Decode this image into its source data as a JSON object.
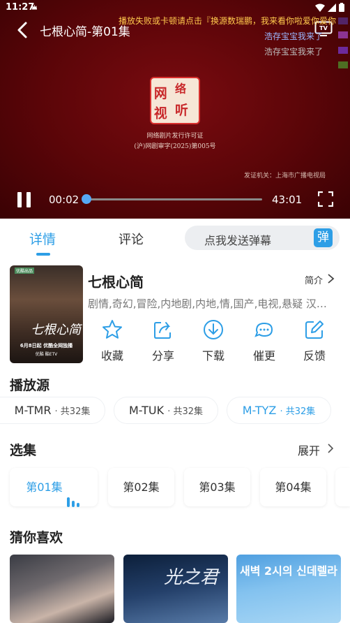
{
  "status_bar": {
    "time": "11:27"
  },
  "player": {
    "title": "七根心简-第01集",
    "danmaku": [
      "播放失败或卡顿请点击『换源数瑞鹏，我来看你啦爱你爱你",
      "浩存宝宝我来了",
      "浩存宝宝我来了"
    ],
    "certificate_line1": "网络剧片发行许可证",
    "certificate_line2": "(沪)网剧审字(2025)第005号",
    "issuer": "发证机关：上海市广播电视局",
    "current_time": "00:02",
    "total_time": "43:01",
    "progress_percent": 0.1,
    "colors": {
      "accent": "#4a9ff0",
      "background": "#5a0508"
    }
  },
  "tabs": {
    "detail_label": "详情",
    "comment_label": "评论",
    "danmu_placeholder": "点我发送弹幕",
    "danmu_button": "弹"
  },
  "show": {
    "title": "七根心简",
    "intro_label": "简介",
    "genres": "剧情,奇幻,冒险,内地剧,内地,情,国产,电视,悬疑 汉…",
    "poster": {
      "title": "七根心简",
      "date": "6月8日起 优酷全网独播",
      "platform": "优酷 酷ETV"
    }
  },
  "actions": [
    {
      "icon": "star-icon",
      "label": "收藏"
    },
    {
      "icon": "share-icon",
      "label": "分享"
    },
    {
      "icon": "download-icon",
      "label": "下载"
    },
    {
      "icon": "remind-icon",
      "label": "催更"
    },
    {
      "icon": "feedback-icon",
      "label": "反馈"
    }
  ],
  "sources": {
    "heading": "播放源",
    "items": [
      {
        "name": "M-TMR",
        "count": "· 共32集"
      },
      {
        "name": "M-TUK",
        "count": "· 共32集"
      },
      {
        "name": "M-TYZ",
        "count": "· 共32集",
        "active": true
      }
    ]
  },
  "episodes": {
    "heading": "选集",
    "expand_label": "展开",
    "items": [
      "第01集",
      "第02集",
      "第03集",
      "第04集"
    ],
    "active_index": 0
  },
  "recommendations": {
    "heading": "猜你喜欢",
    "items": [
      {
        "title": ""
      },
      {
        "title": "光之君"
      },
      {
        "title": "새벽 2시의 신데렐라"
      }
    ]
  }
}
